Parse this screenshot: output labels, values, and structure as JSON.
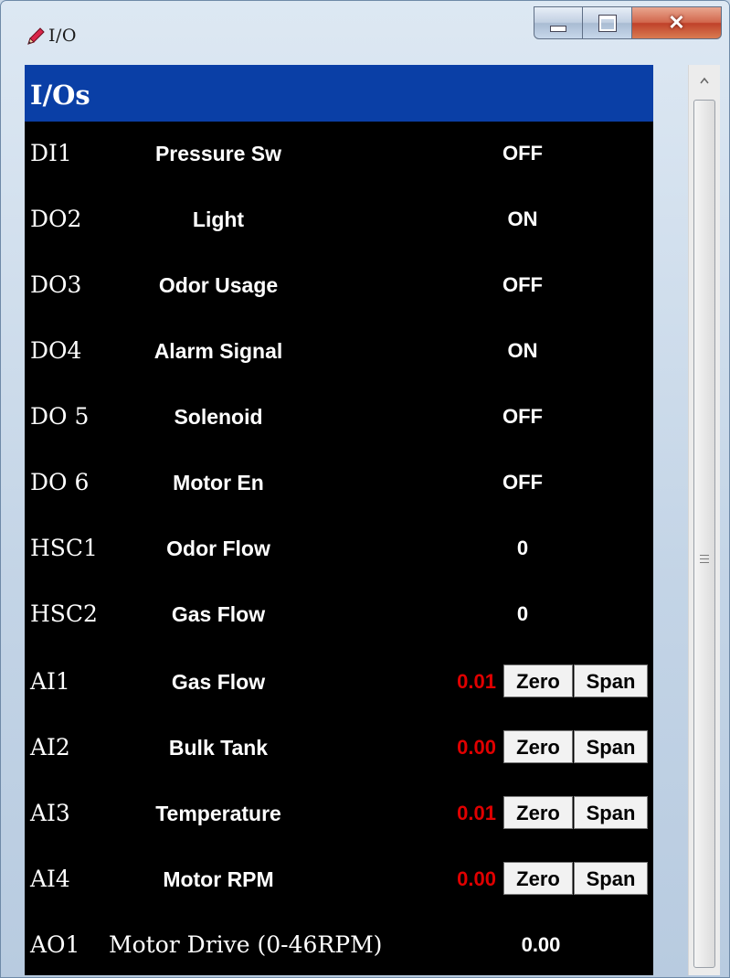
{
  "window": {
    "title": "I/O"
  },
  "header": {
    "title": "I/Os"
  },
  "digital_rows": [
    {
      "id": "DI1",
      "name": "Pressure Sw",
      "state": "OFF"
    },
    {
      "id": "DO2",
      "name": "Light",
      "state": "ON"
    },
    {
      "id": "DO3",
      "name": "Odor Usage",
      "state": "OFF"
    },
    {
      "id": "DO4",
      "name": "Alarm Signal",
      "state": "ON"
    },
    {
      "id": "DO 5",
      "name": "Solenoid",
      "state": "OFF"
    },
    {
      "id": "DO 6",
      "name": "Motor En",
      "state": "OFF"
    },
    {
      "id": "HSC1",
      "name": "Odor Flow",
      "state": "0"
    },
    {
      "id": "HSC2",
      "name": "Gas Flow",
      "state": "0"
    }
  ],
  "analog_rows": [
    {
      "id": "AI1",
      "name": "Gas Flow",
      "value": "0.01",
      "zero_label": "Zero",
      "span_label": "Span"
    },
    {
      "id": "AI2",
      "name": "Bulk Tank",
      "value": "0.00",
      "zero_label": "Zero",
      "span_label": "Span"
    },
    {
      "id": "AI3",
      "name": "Temperature",
      "value": "0.01",
      "zero_label": "Zero",
      "span_label": "Span"
    },
    {
      "id": "AI4",
      "name": "Motor RPM",
      "value": "0.00",
      "zero_label": "Zero",
      "span_label": "Span"
    }
  ],
  "analog_output": {
    "id": "AO1",
    "name": "Motor Drive (0-46RPM)",
    "value": "0.00"
  },
  "colors": {
    "header_bg": "#0a3fa6",
    "panel_bg": "#000000",
    "analog_value": "#e00000",
    "text": "#ffffff",
    "close_button": "#c0412a"
  },
  "icons": {
    "app": "pencil-icon",
    "minimize": "minimize-icon",
    "maximize": "maximize-icon",
    "close": "close-icon",
    "scroll_up": "scroll-up-arrow-icon",
    "grip": "scrollbar-grip-icon"
  }
}
